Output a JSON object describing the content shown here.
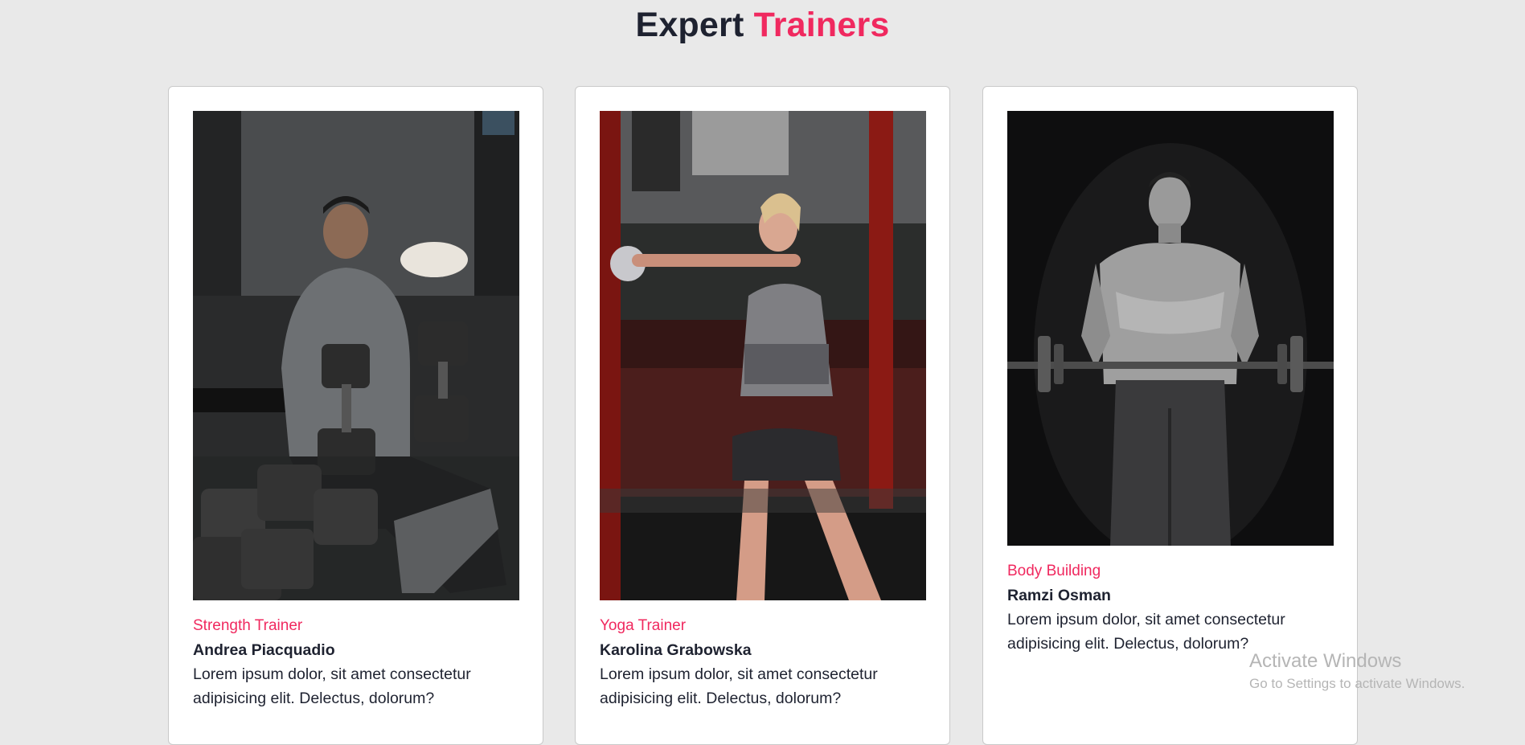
{
  "section": {
    "title_part1": "Expert",
    "title_part2": "Trainers"
  },
  "colors": {
    "accent": "#f0295f",
    "text_dark": "#1e2230",
    "page_bg": "#e9e9e9",
    "card_bg": "#ffffff"
  },
  "trainers": [
    {
      "role": "Strength Trainer",
      "name": "Andrea Piacquadio",
      "description": "Lorem ipsum dolor, sit amet consectetur adipisicing elit. Delectus, dolorum?"
    },
    {
      "role": "Yoga Trainer",
      "name": "Karolina Grabowska",
      "description": "Lorem ipsum dolor, sit amet consectetur adipisicing elit. Delectus, dolorum?"
    },
    {
      "role": "Body Building",
      "name": "Ramzi Osman",
      "description": "Lorem ipsum dolor, sit amet consectetur adipisicing elit. Delectus, dolorum?"
    }
  ],
  "watermark": {
    "title": "Activate Windows",
    "subtitle": "Go to Settings to activate Windows."
  }
}
